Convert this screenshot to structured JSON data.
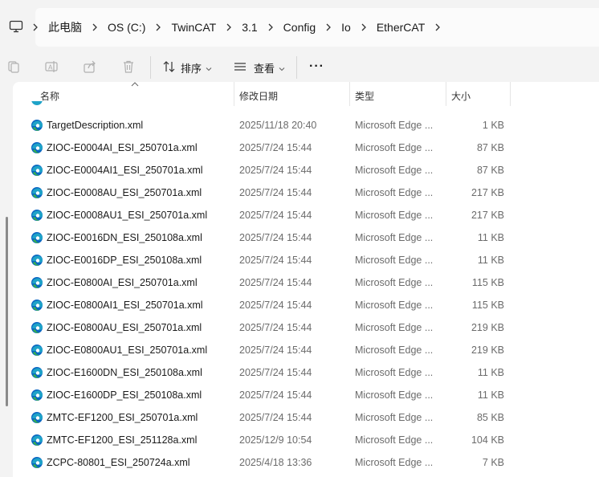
{
  "breadcrumb": {
    "items": [
      "此电脑",
      "OS (C:)",
      "TwinCAT",
      "3.1",
      "Config",
      "Io",
      "EtherCAT"
    ]
  },
  "toolbar": {
    "sort_label": "排序",
    "view_label": "查看",
    "more_label": "···"
  },
  "columns": {
    "name": "名称",
    "date": "修改日期",
    "type": "类型",
    "size": "大小"
  },
  "files": [
    {
      "name": "TargetDescription.xml",
      "date": "2025/11/18 20:40",
      "type": "Microsoft Edge ...",
      "size": "1 KB"
    },
    {
      "name": "ZIOC-E0004AI_ESI_250701a.xml",
      "date": "2025/7/24 15:44",
      "type": "Microsoft Edge ...",
      "size": "87 KB"
    },
    {
      "name": "ZIOC-E0004AI1_ESI_250701a.xml",
      "date": "2025/7/24 15:44",
      "type": "Microsoft Edge ...",
      "size": "87 KB"
    },
    {
      "name": "ZIOC-E0008AU_ESI_250701a.xml",
      "date": "2025/7/24 15:44",
      "type": "Microsoft Edge ...",
      "size": "217 KB"
    },
    {
      "name": "ZIOC-E0008AU1_ESI_250701a.xml",
      "date": "2025/7/24 15:44",
      "type": "Microsoft Edge ...",
      "size": "217 KB"
    },
    {
      "name": "ZIOC-E0016DN_ESI_250108a.xml",
      "date": "2025/7/24 15:44",
      "type": "Microsoft Edge ...",
      "size": "11 KB"
    },
    {
      "name": "ZIOC-E0016DP_ESI_250108a.xml",
      "date": "2025/7/24 15:44",
      "type": "Microsoft Edge ...",
      "size": "11 KB"
    },
    {
      "name": "ZIOC-E0800AI_ESI_250701a.xml",
      "date": "2025/7/24 15:44",
      "type": "Microsoft Edge ...",
      "size": "115 KB"
    },
    {
      "name": "ZIOC-E0800AI1_ESI_250701a.xml",
      "date": "2025/7/24 15:44",
      "type": "Microsoft Edge ...",
      "size": "115 KB"
    },
    {
      "name": "ZIOC-E0800AU_ESI_250701a.xml",
      "date": "2025/7/24 15:44",
      "type": "Microsoft Edge ...",
      "size": "219 KB"
    },
    {
      "name": "ZIOC-E0800AU1_ESI_250701a.xml",
      "date": "2025/7/24 15:44",
      "type": "Microsoft Edge ...",
      "size": "219 KB"
    },
    {
      "name": "ZIOC-E1600DN_ESI_250108a.xml",
      "date": "2025/7/24 15:44",
      "type": "Microsoft Edge ...",
      "size": "11 KB"
    },
    {
      "name": "ZIOC-E1600DP_ESI_250108a.xml",
      "date": "2025/7/24 15:44",
      "type": "Microsoft Edge ...",
      "size": "11 KB"
    },
    {
      "name": "ZMTC-EF1200_ESI_250701a.xml",
      "date": "2025/7/24 15:44",
      "type": "Microsoft Edge ...",
      "size": "85 KB"
    },
    {
      "name": "ZMTC-EF1200_ESI_251128a.xml",
      "date": "2025/12/9 10:54",
      "type": "Microsoft Edge ...",
      "size": "104 KB"
    },
    {
      "name": "ZCPC-80801_ESI_250724a.xml",
      "date": "2025/4/18 13:36",
      "type": "Microsoft Edge ...",
      "size": "7 KB"
    }
  ],
  "icons": {
    "computer": "computer-icon",
    "chevron": "chevron-right-icon",
    "copy": "copy-icon",
    "rename": "rename-icon",
    "share": "share-icon",
    "delete": "delete-icon",
    "sort": "sort-icon",
    "view": "view-icon",
    "edge": "edge-file-icon"
  },
  "colors": {
    "edge_blue": "#0a66c2",
    "edge_green": "#37b24d",
    "edge_teal": "#1fa3c8"
  }
}
